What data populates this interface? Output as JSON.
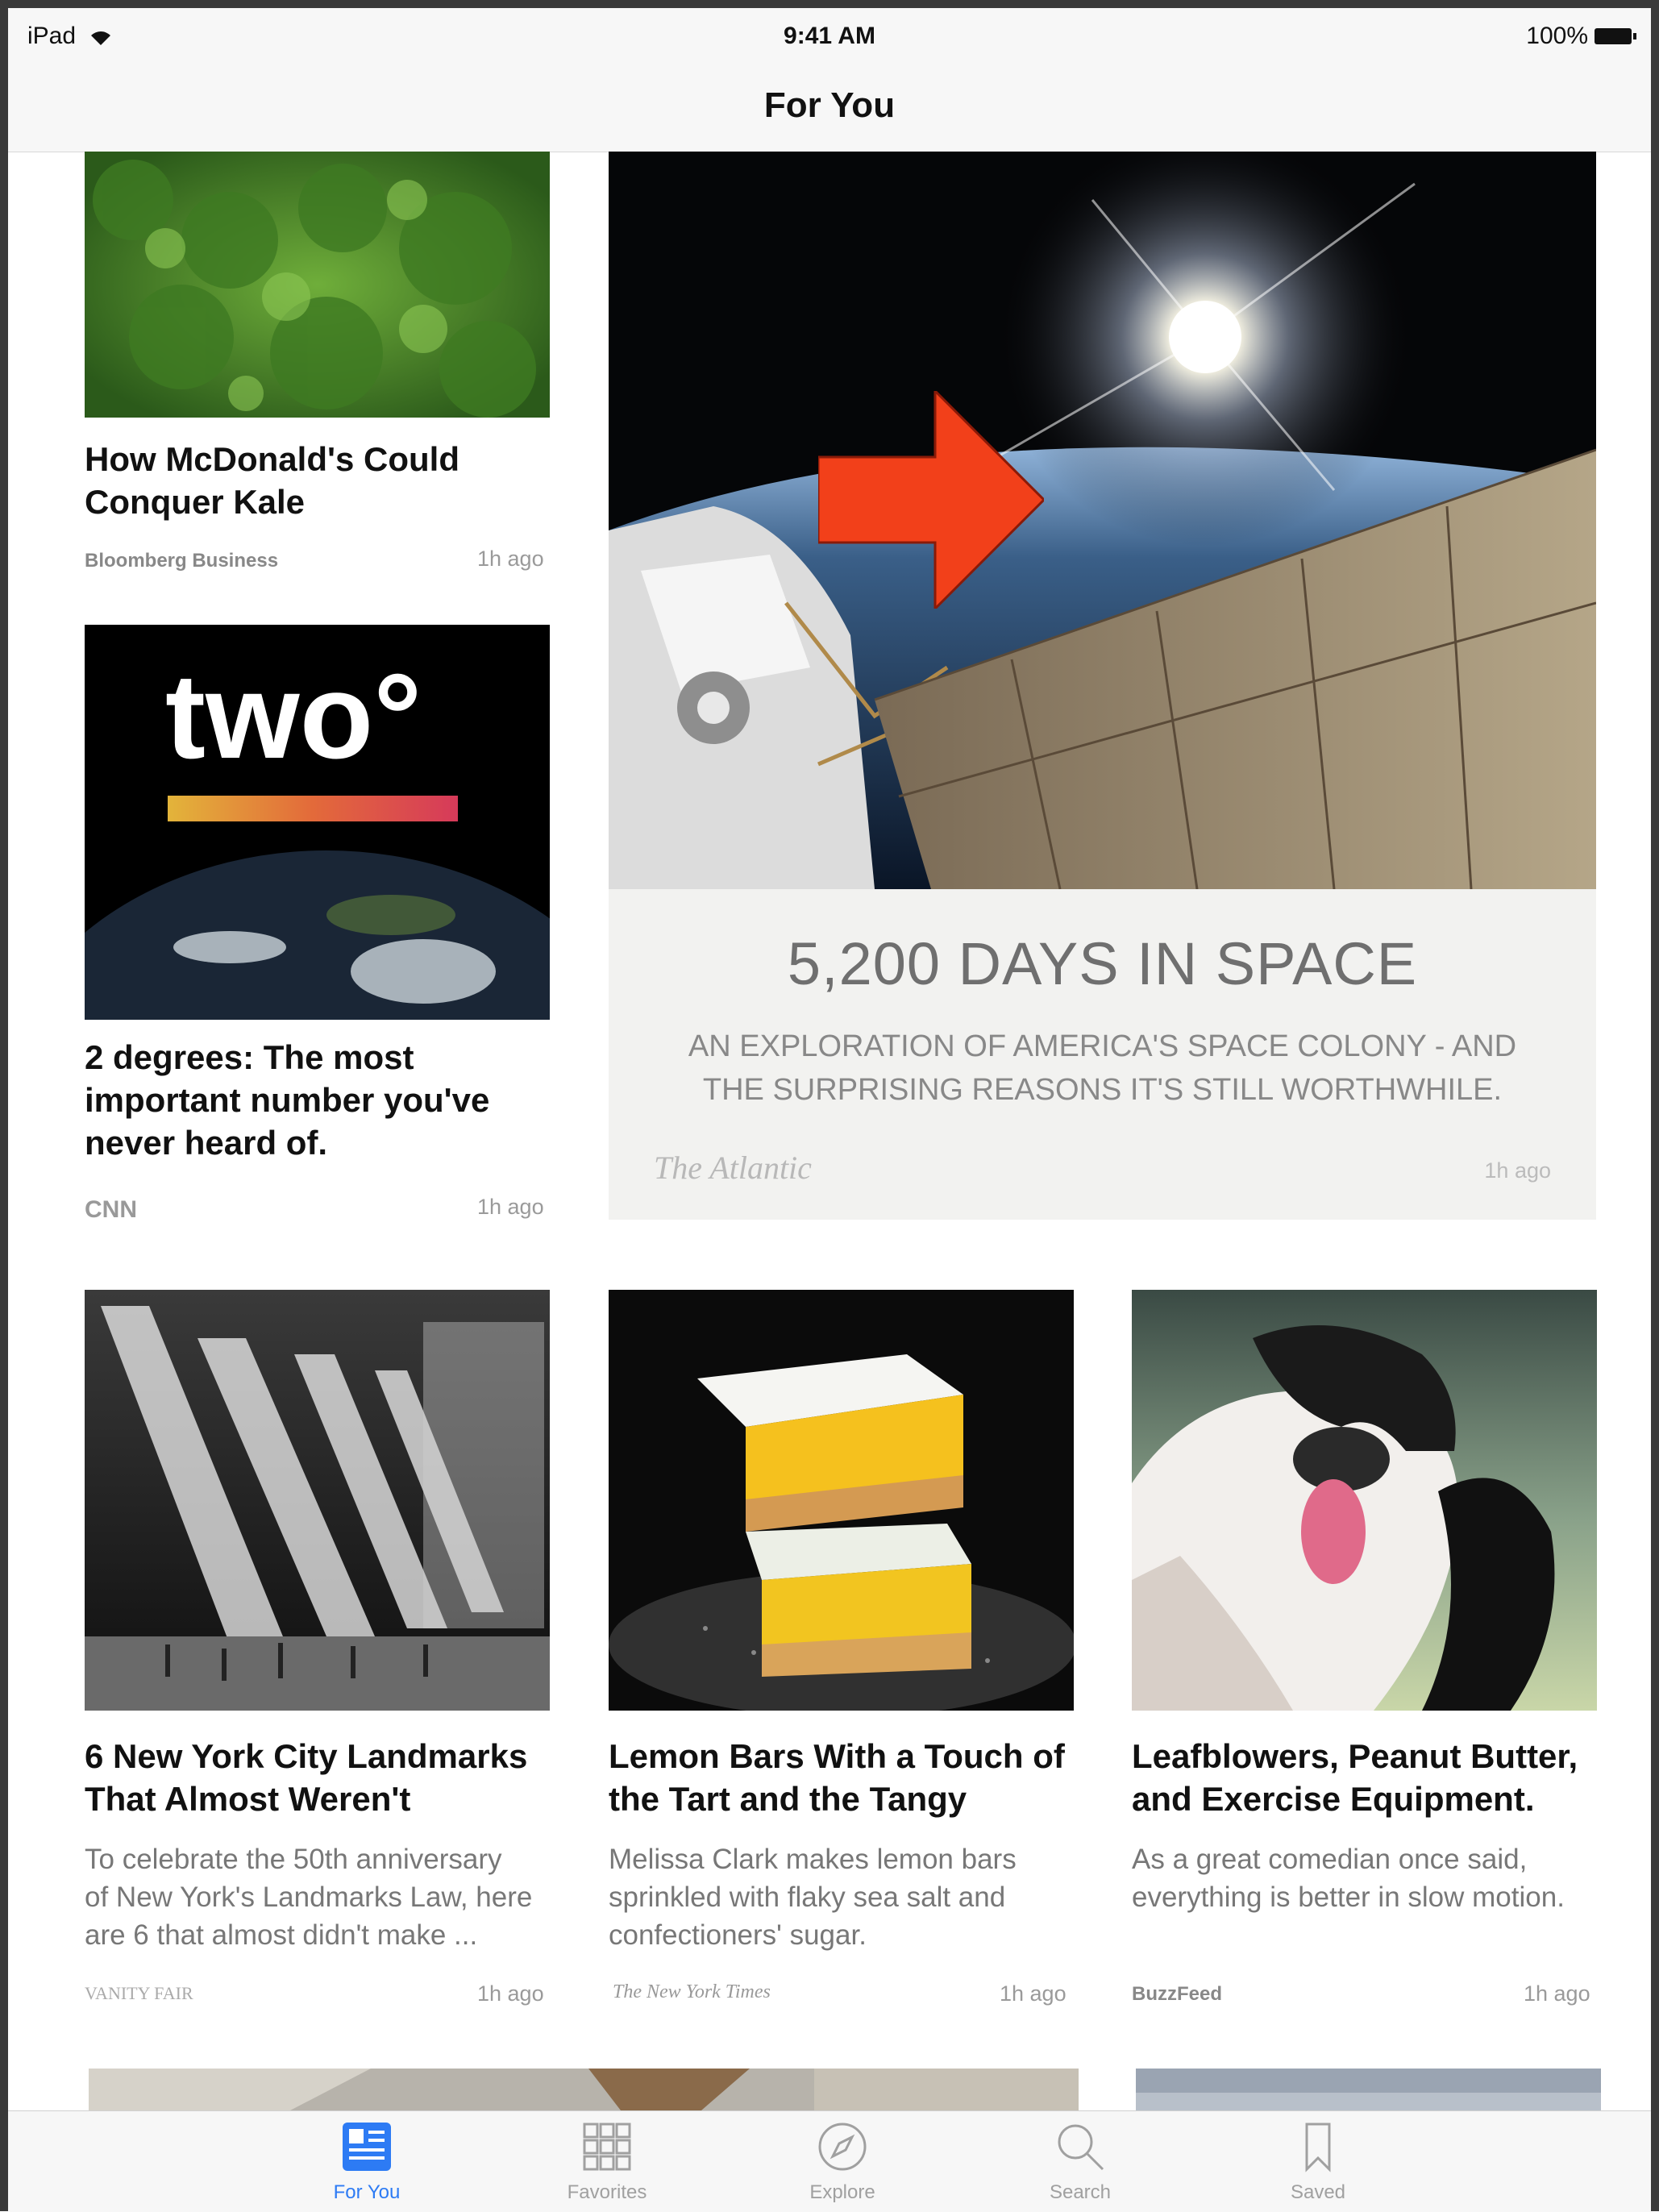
{
  "status_bar": {
    "carrier": "iPad",
    "time": "9:41 AM",
    "battery": "100%"
  },
  "navbar": {
    "title": "For You"
  },
  "articles": [
    {
      "headline_line1": "How McDonald's Could",
      "headline_line2": "Conquer Kale",
      "source": "Bloomberg Business",
      "ago": "1h ago"
    },
    {
      "logo_text": "two°",
      "headline_line1": "2 degrees: The most",
      "headline_line2": "important number you've",
      "headline_line3": "never heard of.",
      "source": "CNN",
      "ago": "1h ago"
    },
    {
      "title": "5,200 DAYS IN SPACE",
      "subtitle_line1": "AN EXPLORATION OF AMERICA'S SPACE COLONY - AND",
      "subtitle_line2": "THE SURPRISING REASONS IT'S STILL WORTHWHILE.",
      "source": "The Atlantic",
      "ago": "1h ago"
    },
    {
      "headline_line1": "6 New York City Landmarks",
      "headline_line2": "That Almost Weren't",
      "summary_line1": "To celebrate the 50th anniversary",
      "summary_line2": "of New York's Landmarks Law, here",
      "summary_line3": "are 6 that almost didn't make ...",
      "source": "VANITY FAIR",
      "ago": "1h ago"
    },
    {
      "headline_line1": "Lemon Bars With a Touch of",
      "headline_line2": "the Tart and the Tangy",
      "summary_line1": "Melissa Clark makes lemon bars",
      "summary_line2": "sprinkled with flaky sea salt and",
      "summary_line3": "confectioners' sugar.",
      "source": "The New York Times",
      "ago": "1h ago"
    },
    {
      "headline_line1": "Leafblowers, Peanut Butter,",
      "headline_line2": "and Exercise Equipment.",
      "summary_line1": "As a great comedian once said,",
      "summary_line2": "everything is better in slow motion.",
      "source": "BuzzFeed",
      "ago": "1h ago"
    }
  ],
  "tabbar": [
    {
      "label": "For You",
      "icon": "news-icon",
      "active": true
    },
    {
      "label": "Favorites",
      "icon": "grid-icon",
      "active": false
    },
    {
      "label": "Explore",
      "icon": "compass-icon",
      "active": false
    },
    {
      "label": "Search",
      "icon": "search-icon",
      "active": false
    },
    {
      "label": "Saved",
      "icon": "bookmark-icon",
      "active": false
    }
  ],
  "colors": {
    "accent": "#2d7bf4",
    "arrow": "#f2401a"
  }
}
